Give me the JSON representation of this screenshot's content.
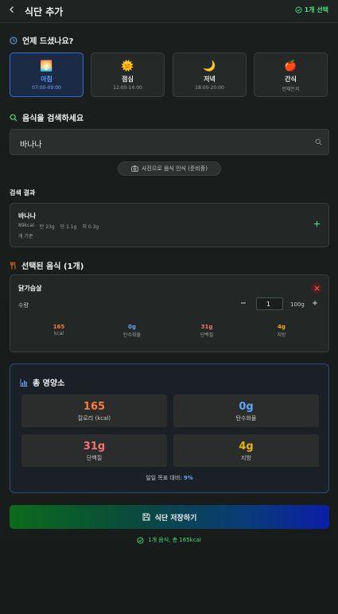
{
  "header": {
    "title": "식단 추가",
    "selected_badge": "1개 선택"
  },
  "meal_section": {
    "title": "언제 드셨나요?",
    "meals": [
      {
        "emoji": "🌅",
        "name": "아침",
        "time": "07:00-09:00",
        "active": true
      },
      {
        "emoji": "🌞",
        "name": "점심",
        "time": "12:00-14:00",
        "active": false
      },
      {
        "emoji": "🌙",
        "name": "저녁",
        "time": "18:00-20:00",
        "active": false
      },
      {
        "emoji": "🍎",
        "name": "간식",
        "time": "언제든지",
        "active": false
      }
    ]
  },
  "search": {
    "title": "음식을 검색하세요",
    "value": "바나나",
    "photo_button": "사진으로 음식 인식 (준비중)"
  },
  "results": {
    "title": "검색 결과",
    "items": [
      {
        "name": "바나나",
        "kcal": "89kcal",
        "carb": "탄 23g",
        "protein": "단 1.1g",
        "fat": "지 0.3g",
        "unit": "개 기준"
      }
    ]
  },
  "selected": {
    "title": "선택된 음식 (1개)",
    "items": [
      {
        "name": "닭가슴살",
        "qty_label": "수량",
        "qty": "1",
        "unit": "100g",
        "stats": [
          {
            "value": "165",
            "label": "kcal",
            "color": "#ff7a3d"
          },
          {
            "value": "0g",
            "label": "탄수화물",
            "color": "#60a5fa"
          },
          {
            "value": "31g",
            "label": "단백질",
            "color": "#f87171"
          },
          {
            "value": "4g",
            "label": "지방",
            "color": "#eab308"
          }
        ]
      }
    ]
  },
  "totals": {
    "title": "총 영양소",
    "stats": [
      {
        "value": "165",
        "label": "칼로리 (kcal)",
        "color": "#ff7a3d"
      },
      {
        "value": "0g",
        "label": "탄수화물",
        "color": "#60a5fa"
      },
      {
        "value": "31g",
        "label": "단백질",
        "color": "#f87171"
      },
      {
        "value": "4g",
        "label": "지방",
        "color": "#eab308"
      }
    ],
    "goal_prefix": "일일 목표 대비: ",
    "goal_value": "9%"
  },
  "save_button": "식단 저장하기",
  "summary": "1개 음식, 총 165kcal"
}
